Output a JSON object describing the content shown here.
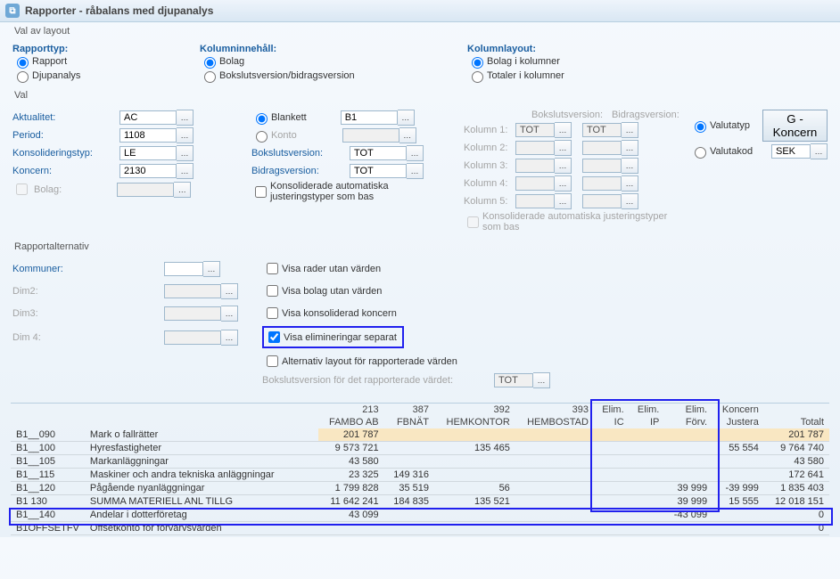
{
  "title": "Rapporter - råbalans med djupanalys",
  "groups": {
    "layout": {
      "label": "Val av layout",
      "cols": [
        {
          "title": "Rapporttyp:",
          "opts": [
            "Rapport",
            "Djupanalys"
          ],
          "sel": 0
        },
        {
          "title": "Kolumninnehåll:",
          "opts": [
            "Bolag",
            "Bokslutsversion/bidragsversion"
          ],
          "sel": 0
        },
        {
          "title": "Kolumnlayout:",
          "opts": [
            "Bolag i kolumner",
            "Totaler i kolumner"
          ],
          "sel": 0
        }
      ]
    },
    "val": {
      "label": "Val",
      "rows": {
        "akt": {
          "lbl": "Aktualitet:",
          "val": "AC"
        },
        "per": {
          "lbl": "Period:",
          "val": "1108"
        },
        "kon": {
          "lbl": "Konsolideringstyp:",
          "val": "LE"
        },
        "knc": {
          "lbl": "Koncern:",
          "val": "2130"
        },
        "bol": {
          "lbl": "Bolag:",
          "val": ""
        }
      },
      "mid": {
        "blankett": {
          "lbl": "Blankett",
          "val": "B1",
          "sel": true
        },
        "konto": {
          "lbl": "Konto",
          "val": ""
        },
        "bv": {
          "lbl": "Bokslutsversion:",
          "val": "TOT"
        },
        "bid": {
          "lbl": "Bidragsversion:",
          "val": "TOT"
        },
        "chk": {
          "lbl": "Konsoliderade automatiska justeringstyper som bas"
        }
      },
      "right": {
        "bv": {
          "lbl": "Bokslutsversion:"
        },
        "bid": {
          "lbl": "Bidragsversion:"
        },
        "kols": [
          "Kolumn 1:",
          "Kolumn 2:",
          "Kolumn 3:",
          "Kolumn 4:",
          "Kolumn 5:"
        ],
        "tot": "TOT",
        "chk": "Konsoliderade automatiska justeringstyper som bas"
      },
      "far": {
        "rt": {
          "opts": [
            "Valutatyp",
            "Valutakod"
          ],
          "sel": 0
        },
        "btn": "G - Koncern",
        "cur": "SEK"
      }
    },
    "ralt": {
      "label": "Rapportalternativ",
      "left": [
        {
          "lbl": "Kommuner:",
          "enabled": true
        },
        {
          "lbl": "Dim2:",
          "enabled": false
        },
        {
          "lbl": "Dim3:",
          "enabled": false
        },
        {
          "lbl": "Dim 4:",
          "enabled": false
        }
      ],
      "chks": [
        "Visa rader utan värden",
        "Visa bolag utan värden",
        "Visa konsoliderad koncern",
        "Visa elimineringar separat",
        "Alternativ layout för rapporterade värden"
      ],
      "chk_sel": 3,
      "bvline": {
        "lbl": "Bokslutsversion för det rapporterade värdet:",
        "val": "TOT"
      }
    }
  },
  "chart_data": {
    "type": "table",
    "title": "",
    "header1": [
      "",
      "",
      "213",
      "387",
      "392",
      "393",
      "Elim.",
      "Elim.",
      "Elim.",
      "Koncern",
      ""
    ],
    "header2": [
      "",
      "",
      "FAMBO AB",
      "FBNÄT",
      "HEMKONTOR",
      "HEMBOSTAD",
      "IC",
      "IP",
      "Förv.",
      "Justera",
      "Totalt"
    ],
    "rows": [
      {
        "code": "B1__090",
        "desc": "Mark o fallrätter",
        "cells": [
          "201 787",
          "",
          "",
          "",
          "",
          "",
          "",
          "",
          "201 787"
        ],
        "hl": "090"
      },
      {
        "code": "B1__100",
        "desc": "Hyresfastigheter",
        "cells": [
          "9 573 721",
          "",
          "135 465",
          "",
          "",
          "",
          "",
          "55 554",
          "9 764 740"
        ]
      },
      {
        "code": "B1__105",
        "desc": "Markanläggningar",
        "cells": [
          "43 580",
          "",
          "",
          "",
          "",
          "",
          "",
          "",
          "43 580"
        ]
      },
      {
        "code": "B1__115",
        "desc": "Maskiner och andra tekniska anläggningar",
        "cells": [
          "23 325",
          "149 316",
          "",
          "",
          "",
          "",
          "",
          "",
          "172 641"
        ]
      },
      {
        "code": "B1__120",
        "desc": "Pågående nyanläggningar",
        "cells": [
          "1 799 828",
          "35 519",
          "56",
          "",
          "",
          "",
          "39 999",
          "-39 999",
          "1 835 403"
        ]
      },
      {
        "code": "B1   130",
        "desc": "SUMMA  MATERIELL  ANL TILLG",
        "cells": [
          "11 642 241",
          "184 835",
          "135 521",
          "",
          "",
          "",
          "39 999",
          "15 555",
          "12 018 151"
        ],
        "sum": true
      },
      {
        "code": "B1__140",
        "desc": "Andelar i dotterföretag",
        "cells": [
          "43 099",
          "",
          "",
          "",
          "",
          "",
          "-43 099",
          "",
          "0"
        ],
        "box": true
      },
      {
        "code": "B1OFFSETFV",
        "desc": "Offsetkonto för förvärvsvärden",
        "cells": [
          "",
          "",
          "",
          "",
          "",
          "",
          "",
          "",
          "0"
        ]
      }
    ]
  }
}
